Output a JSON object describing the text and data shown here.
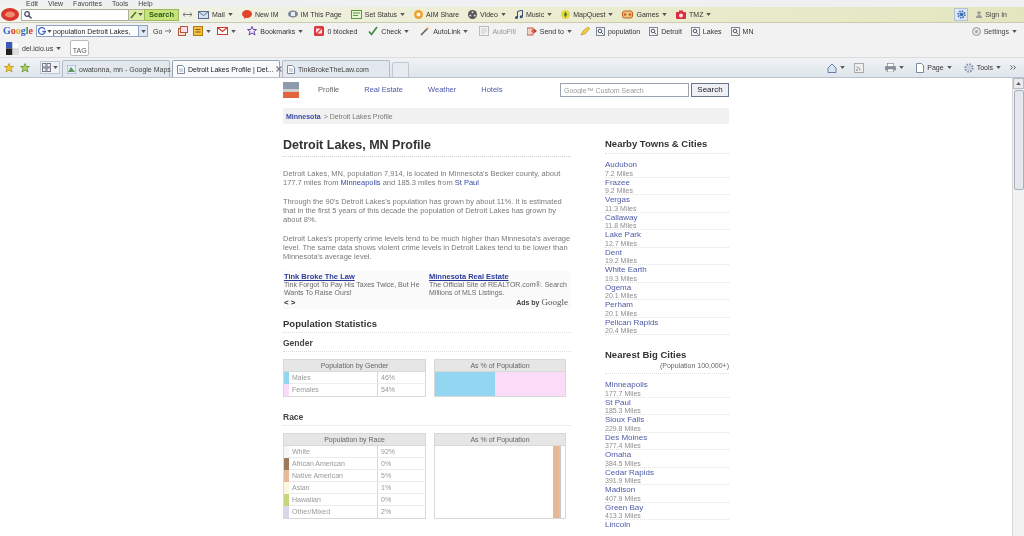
{
  "menu_bar": {
    "items": [
      "Edit",
      "View",
      "Favorites",
      "Tools",
      "Help"
    ]
  },
  "aol_toolbar": {
    "search_button": "Search",
    "items": [
      {
        "label": "Mail",
        "dropdown": true
      },
      {
        "label": "New IM",
        "dropdown": false
      },
      {
        "label": "IM This Page",
        "dropdown": false
      },
      {
        "label": "Set Status",
        "dropdown": true
      },
      {
        "label": "AIM Share",
        "dropdown": false
      },
      {
        "label": "Video",
        "dropdown": true
      },
      {
        "label": "Music",
        "dropdown": true
      },
      {
        "label": "MapQuest",
        "dropdown": true
      },
      {
        "label": "Games",
        "dropdown": true
      },
      {
        "label": "TMZ",
        "dropdown": true
      }
    ],
    "sign_in": "Sign In"
  },
  "google_toolbar": {
    "logo": "Google",
    "query": "population Detroit Lakes,",
    "go": "Go",
    "items": [
      {
        "label": "Bookmarks",
        "dropdown": true,
        "disabled": false
      },
      {
        "label": "0 blocked",
        "dropdown": false,
        "disabled": false
      },
      {
        "label": "Check",
        "dropdown": true,
        "disabled": false
      },
      {
        "label": "AutoLink",
        "dropdown": true,
        "disabled": false
      },
      {
        "label": "AutoFill",
        "dropdown": false,
        "disabled": true
      },
      {
        "label": "Send to",
        "dropdown": true,
        "disabled": false
      }
    ],
    "search_terms": [
      "population",
      "Detroit",
      "Lakes",
      "MN"
    ],
    "settings": "Settings"
  },
  "delicious_toolbar": {
    "label": "del.icio.us",
    "tag": "TAG"
  },
  "tabs": [
    {
      "title": "owatonna, mn - Google Maps",
      "selected": false
    },
    {
      "title": "Detroit Lakes Profile | Det...",
      "selected": true
    },
    {
      "title": "TinkBrokeTheLaw.com",
      "selected": false
    }
  ],
  "command_bar": {
    "page": "Page",
    "tools": "Tools"
  },
  "page": {
    "nav": [
      {
        "label": "Profile",
        "selected": true
      },
      {
        "label": "Real Estate",
        "selected": false
      },
      {
        "label": "Weather",
        "selected": false
      },
      {
        "label": "Hotels",
        "selected": false
      }
    ],
    "search": {
      "placeholder": "Google™ Custom Search",
      "button": "Search"
    },
    "breadcrumb": {
      "link": "Minnesota",
      "current": "> Detroit Lakes Profile"
    },
    "title": "Detroit Lakes, MN Profile",
    "paragraphs": [
      [
        {
          "kind": "text",
          "text": "Detroit Lakes, MN, population 7,914, is located in Minnesota's Becker county, about 177.7 miles from "
        },
        {
          "kind": "link",
          "text": "Minneapolis"
        },
        {
          "kind": "text",
          "text": " and 185.3 miles from "
        },
        {
          "kind": "link",
          "text": "St Paul"
        }
      ],
      [
        {
          "kind": "text",
          "text": "Through the 90's Detroit Lakes's population has grown by about 11%. It is estimated that in the first 5 years of this decade the population of Detroit Lakes has grown by about 8%."
        }
      ],
      [
        {
          "kind": "text",
          "text": "Detroit Lakes's property crime levels tend to be much higher than Minnesota's average level. The same data shows violent crime levels in Detroit Lakes tend to be lower than Minnesota's average level."
        }
      ]
    ],
    "ads": {
      "items": [
        {
          "title": "Tink Broke The Law",
          "text": "Tink Forgot To Pay His Taxes Twice, But He Wants To Raise Ours!"
        },
        {
          "title": "Minnesota Real Estate",
          "text": "The Official Site of REALTOR.com®. Search Millions of MLS Listings."
        }
      ],
      "prev": "<",
      "next": ">",
      "attribution": "Ads by",
      "attribution_logo": "Google"
    },
    "stats": {
      "title": "Population Statistics",
      "sections": [
        {
          "title": "Gender",
          "kind": "split",
          "table_header": "Population by Gender",
          "chart_header": "As % of Population",
          "rows": [
            {
              "label": "Males",
              "value": "46%",
              "color": "#92d6f2"
            },
            {
              "label": "Females",
              "value": "54%",
              "color": "#fadcf8"
            }
          ]
        },
        {
          "title": "Race",
          "kind": "column",
          "table_header": "Population by Race",
          "chart_header": "As % of Population",
          "rows": [
            {
              "label": "White",
              "value": "92%",
              "color": "#f6f6f2"
            },
            {
              "label": "African American",
              "value": "0%",
              "color": "#9c7b5c"
            },
            {
              "label": "Native American",
              "value": "5%",
              "color": "#e6bb9c"
            },
            {
              "label": "Asian",
              "value": "1%",
              "color": "#fbf6dc"
            },
            {
              "label": "Hawaiian",
              "value": "0%",
              "color": "#c6d67e"
            },
            {
              "label": "Other/Mixed",
              "value": "2%",
              "color": "#d8d8ea"
            }
          ]
        }
      ]
    },
    "nearby": {
      "title": "Nearby Towns & Cities",
      "items": [
        {
          "name": "Audubon",
          "distance": "7.2 Miles"
        },
        {
          "name": "Frazee",
          "distance": "9.2 Miles"
        },
        {
          "name": "Vergas",
          "distance": "11.3 Miles"
        },
        {
          "name": "Callaway",
          "distance": "11.8 Miles"
        },
        {
          "name": "Lake Park",
          "distance": "12.7 Miles"
        },
        {
          "name": "Dent",
          "distance": "19.2 Miles"
        },
        {
          "name": "White Earth",
          "distance": "19.3 Miles"
        },
        {
          "name": "Ogema",
          "distance": "20.1 Miles"
        },
        {
          "name": "Perham",
          "distance": "20.1 Miles"
        },
        {
          "name": "Pelican Rapids",
          "distance": "20.4 Miles"
        }
      ]
    },
    "big_cities": {
      "title": "Nearest Big Cities",
      "note": "(Population 100,000+)",
      "items": [
        {
          "name": "Minneapolis",
          "distance": "177.7 Miles"
        },
        {
          "name": "St Paul",
          "distance": "185.3 Miles"
        },
        {
          "name": "Sioux Falls",
          "distance": "229.8 Miles"
        },
        {
          "name": "Des Moines",
          "distance": "377.4 Miles"
        },
        {
          "name": "Omaha",
          "distance": "384.5 Miles"
        },
        {
          "name": "Cedar Rapids",
          "distance": "391.9 Miles"
        },
        {
          "name": "Madison",
          "distance": "407.9 Miles"
        },
        {
          "name": "Green Bay",
          "distance": "413.3 Miles"
        },
        {
          "name": "Lincoln"
        }
      ]
    }
  }
}
